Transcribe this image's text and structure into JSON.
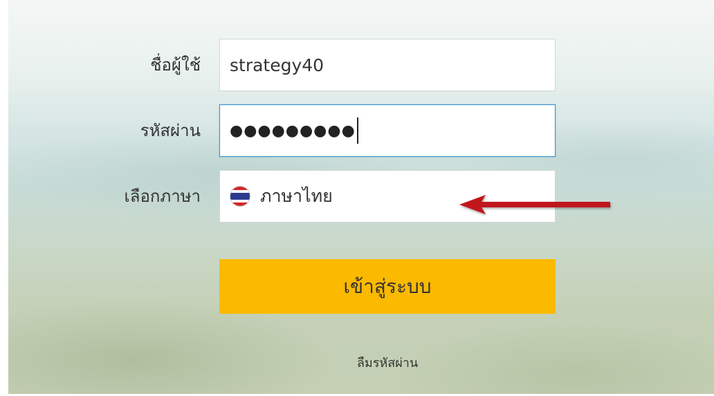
{
  "form": {
    "username_label": "ชื่อผู้ใช้",
    "username_value": "strategy40",
    "password_label": "รหัสผ่าน",
    "password_masked": "●●●●●●●●●",
    "language_label": "เลือกภาษา",
    "language_value": "ภาษาไทย",
    "language_flag_icon": "thailand-flag-icon",
    "login_button_label": "เข้าสู่ระบบ",
    "forgot_password_label": "ลืมรหัสผ่าน"
  },
  "annotation": {
    "arrow_icon": "red-arrow-left-icon",
    "arrow_color": "#c1121f"
  },
  "colors": {
    "login_button": "#fbb900",
    "focus_border": "#2e8fc5"
  }
}
